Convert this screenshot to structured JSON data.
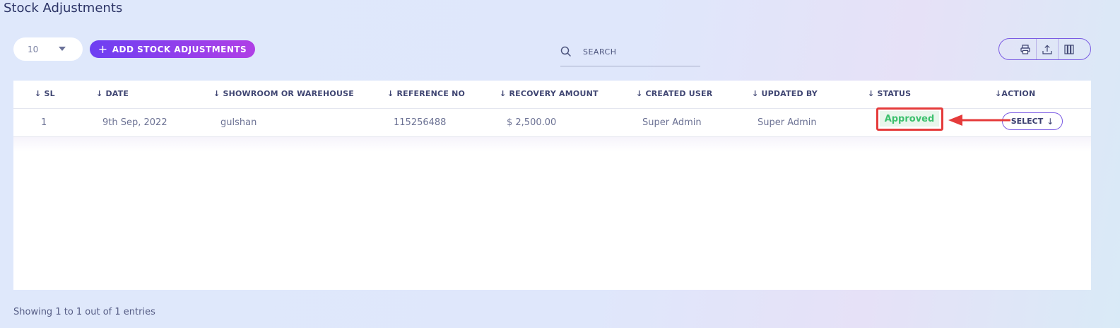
{
  "page": {
    "title": "Stock Adjustments"
  },
  "toolbar": {
    "per_page": "10",
    "add_label": "ADD STOCK ADJUSTMENTS",
    "search_placeholder": "SEARCH",
    "tools": [
      "print-icon",
      "export-icon",
      "columns-icon"
    ]
  },
  "table": {
    "headers": [
      "SL",
      "DATE",
      "SHOWROOM OR WAREHOUSE",
      "REFERENCE NO",
      "RECOVERY AMOUNT",
      "CREATED USER",
      "UPDATED BY",
      "STATUS",
      "ACTION"
    ],
    "rows": [
      {
        "sl": "1",
        "date": "9th Sep, 2022",
        "location": "gulshan",
        "reference": "115256488",
        "amount": "$ 2,500.00",
        "created_by": "Super Admin",
        "updated_by": "Super Admin",
        "status": "Approved",
        "action": "SELECT"
      }
    ]
  },
  "footer": {
    "info": "Showing 1 to 1 out of 1 entries"
  },
  "colors": {
    "accent": "#6d3ff2",
    "status_green": "#3cc06d",
    "highlight_red": "#e53b3b"
  }
}
